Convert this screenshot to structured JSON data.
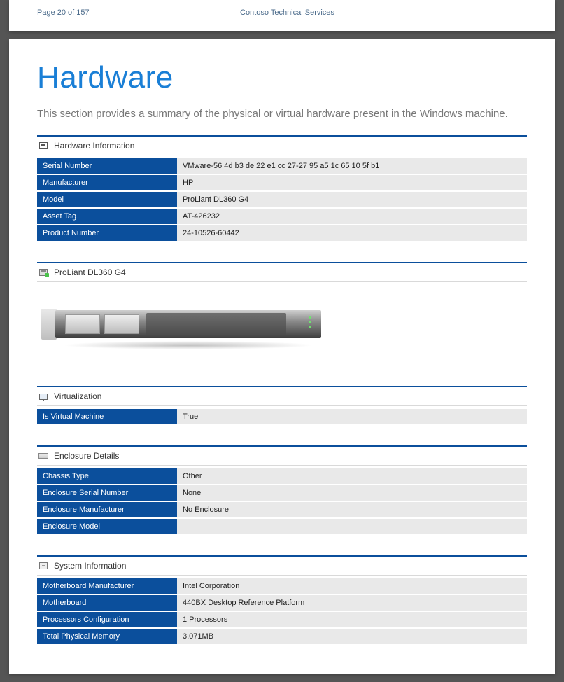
{
  "header": {
    "page_label": "Page 20 of 157",
    "doc_title": "Contoso Technical Services"
  },
  "title": "Hardware",
  "description": "This section provides a summary of the physical or virtual hardware present in the Windows machine.",
  "sections": {
    "hardware_info": {
      "title": "Hardware Information",
      "rows": [
        {
          "k": "Serial Number",
          "v": "VMware-56 4d b3 de 22 e1 cc 27-27 95 a5 1c 65 10 5f b1"
        },
        {
          "k": "Manufacturer",
          "v": "HP"
        },
        {
          "k": "Model",
          "v": "ProLiant DL360 G4"
        },
        {
          "k": "Asset Tag",
          "v": "AT-426232"
        },
        {
          "k": "Product Number",
          "v": "24-10526-60442"
        }
      ]
    },
    "product_image": {
      "title": "ProLiant DL360 G4"
    },
    "virtualization": {
      "title": "Virtualization",
      "rows": [
        {
          "k": "Is Virtual Machine",
          "v": "True"
        }
      ]
    },
    "enclosure": {
      "title": "Enclosure Details",
      "rows": [
        {
          "k": "Chassis Type",
          "v": "Other"
        },
        {
          "k": "Enclosure Serial Number",
          "v": "None"
        },
        {
          "k": "Enclosure Manufacturer",
          "v": "No Enclosure"
        },
        {
          "k": "Enclosure Model",
          "v": ""
        }
      ]
    },
    "system_info": {
      "title": "System Information",
      "rows": [
        {
          "k": "Motherboard Manufacturer",
          "v": "Intel Corporation"
        },
        {
          "k": "Motherboard",
          "v": "440BX Desktop Reference Platform"
        },
        {
          "k": "Processors Configuration",
          "v": "1 Processors"
        },
        {
          "k": "Total Physical Memory",
          "v": "3,071MB"
        }
      ]
    }
  }
}
